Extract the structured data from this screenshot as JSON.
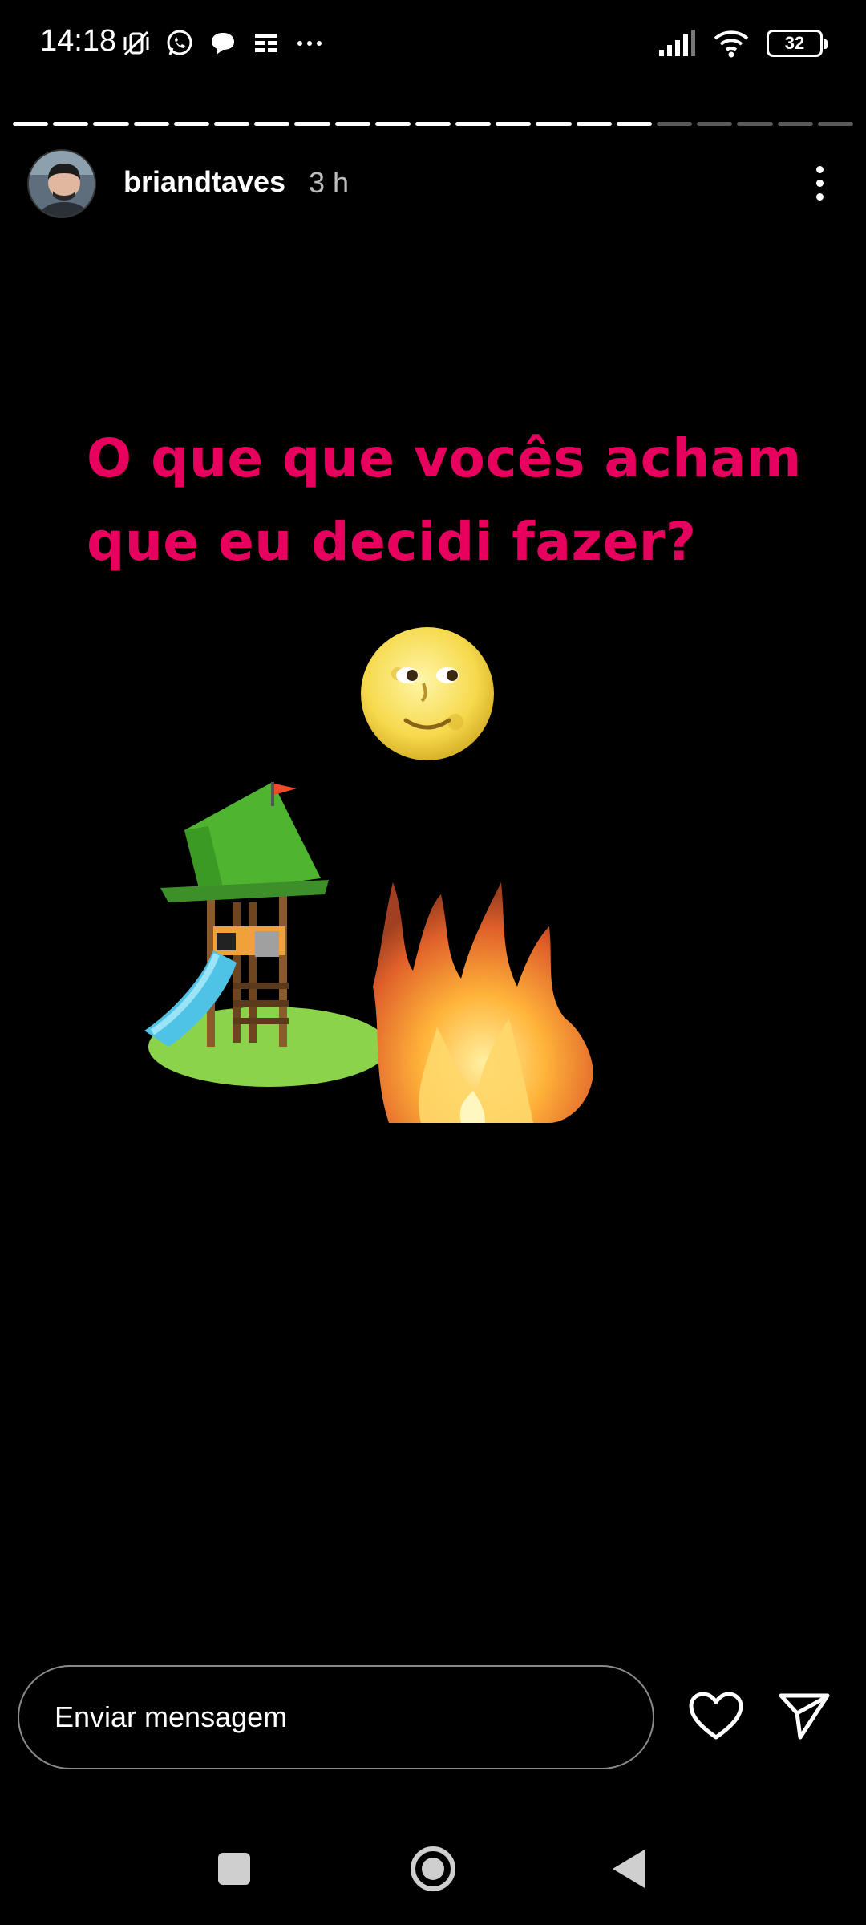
{
  "status_bar": {
    "time": "14:18",
    "icons_left": [
      "mute-vibrate-icon",
      "whatsapp-icon",
      "chat-bubble-icon",
      "news-feed-icon",
      "more-dots-icon"
    ],
    "icons_right": [
      "signal-icon",
      "wifi-icon",
      "battery-icon"
    ],
    "battery": "32"
  },
  "story": {
    "progress": {
      "total_segments": 21,
      "completed_segments": 16
    },
    "header": {
      "username": "briandtaves",
      "time_ago": "3 h"
    },
    "text_line1": "O que que vocês acham",
    "text_line2": "que eu decidi fazer?",
    "text_color": "#e8005f",
    "stickers": [
      "full-moon-face",
      "playground-slide",
      "fire"
    ]
  },
  "reply": {
    "placeholder": "Enviar mensagem"
  },
  "navigation": {
    "buttons": [
      "recents",
      "home",
      "back"
    ]
  }
}
